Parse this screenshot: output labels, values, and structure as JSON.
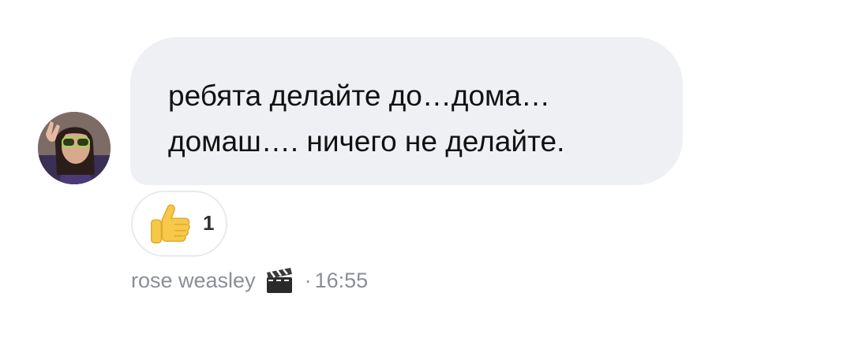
{
  "message": {
    "lines": [
      "ребята делайте до…дома…",
      "домаш…. ничего не делайте."
    ]
  },
  "reaction": {
    "emoji": "thumbs-up-icon",
    "count": "1"
  },
  "meta": {
    "author": "rose weasley",
    "author_emoji": "clapper-board-icon",
    "separator": "·",
    "time": "16:55"
  },
  "colors": {
    "bubble": "#eef0f3",
    "text": "#111111",
    "meta_text": "#8a8f96",
    "reaction_border": "#e8eaee",
    "thumb": "#f7c84a"
  }
}
